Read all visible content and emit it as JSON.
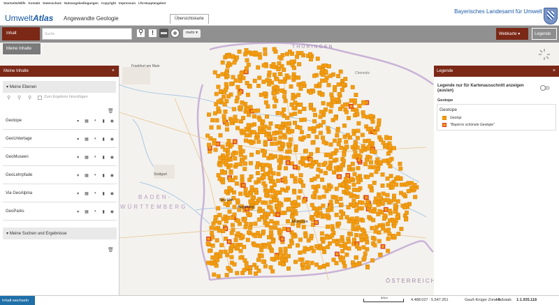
{
  "top_links": [
    "Startseite/Hilfe",
    "Kontakt",
    "Datenschutz",
    "Nutzungsbedingungen",
    "Copyright",
    "Impressum",
    "LfU-Hauptangebot"
  ],
  "header": {
    "logo_plain": "Umwelt",
    "logo_bold": "Atlas",
    "subtitle": "Angewandte Geologie",
    "overview_button": "Übersichtskarte",
    "ministry": "Bayerisches Landesamt für Umwelt"
  },
  "toolbar": {
    "content_button": "Inhalt",
    "search_placeholder": "Suche",
    "more_label": "mehr",
    "basemap_button": "Webkarte",
    "legend_button": "Legende",
    "my_content_button": "Meine Inhalte"
  },
  "left_panel": {
    "title": "Meine Inhalte",
    "section_layers": "Meine Ebenen",
    "add_to_results": "Zum Ergebnis hinzufügen",
    "layers": [
      {
        "name": "Geotope"
      },
      {
        "name": "GeoUntertage"
      },
      {
        "name": "GeoMuseen"
      },
      {
        "name": "GeoLehrpfade"
      },
      {
        "name": "Via GeoAlpina"
      },
      {
        "name": "GeoParks"
      }
    ],
    "section_search": "Meine Suchen und Ergebnisse"
  },
  "right_panel": {
    "title": "Legende",
    "toggle_label": "Legende nur für Kartenausschnitt anzeigen (aus/an)",
    "group": "Geotope",
    "layer": "Geotope",
    "items": [
      {
        "label": "Geotop",
        "color": "#f39c12",
        "border": "#e08a00"
      },
      {
        "label": "\"Bayerns schönste Geotope\"",
        "color": "#f39c12",
        "border": "#d9342b"
      }
    ]
  },
  "map_labels": {
    "thueringen": "THÜRINGEN",
    "chemnitz": "Chemnitz",
    "frankfurt": "Frankfurt am Main",
    "stuttgart": "Stuttgart",
    "baden": "BADEN-",
    "wuerttemberg": "WÜRTTEMBERG",
    "augsburg": "Augsburg",
    "muenchen": "München",
    "oesterreich": "ÖSTERREICH",
    "neu_ulm": "Neu-Ulm"
  },
  "colors": {
    "accent": "#7b2817",
    "marker_fill": "#f39c12",
    "marker_stroke": "#d48200",
    "marker_highlight": "#d9342b",
    "status_blue": "#1f6fa8"
  },
  "status": {
    "switch_content": "Inhalt wechseln",
    "scale_bar": "80km",
    "coordinates": "4.488.027 : 5.547.251",
    "crs": "Gauß-Krüger Zone 4",
    "scale_label": "Maßstab:",
    "scale_value": "1:1.935.118"
  }
}
